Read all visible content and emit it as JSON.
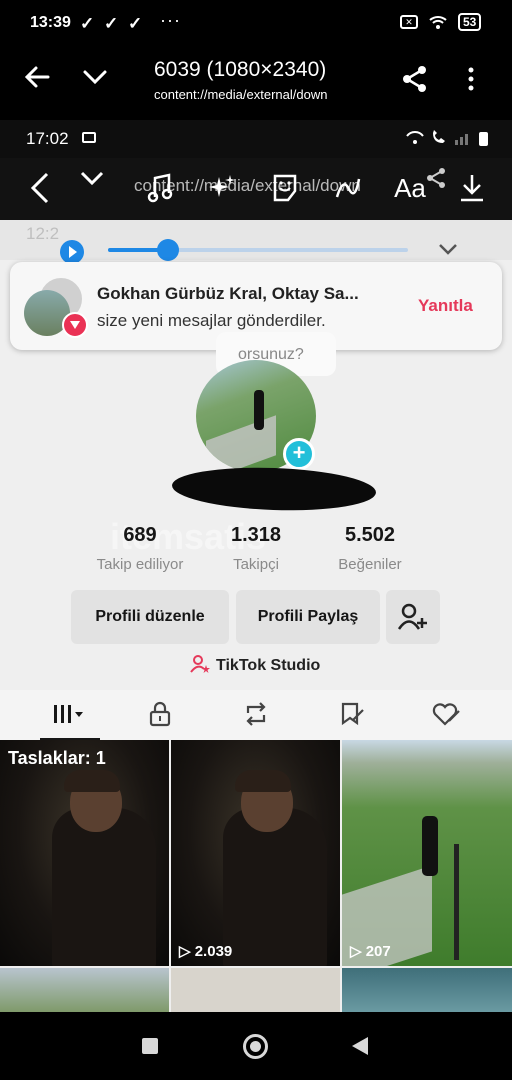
{
  "outer_status": {
    "time": "13:39",
    "dots": "···",
    "battery": "53",
    "check": "✓"
  },
  "viewer": {
    "title": "6039 (1080×2340)",
    "subtitle": "content://media/external/down"
  },
  "inner_status": {
    "time": "17:02"
  },
  "editor": {
    "ghost_url": "content://media/external/down",
    "text_tool_label": "Aa",
    "ghost_time": "12:2"
  },
  "notification": {
    "title": "Gokhan Gürbüz Kral, Oktay Sa...",
    "text": "size yeni mesajlar gönderdiler.",
    "reply_label": "Yanıtla"
  },
  "progress": {
    "fraction": 0.2
  },
  "profile": {
    "bubble_text": "orsunuz?",
    "plus": "+",
    "watermark": "itemsatis"
  },
  "stats": [
    {
      "value": "689",
      "label": "Takip ediliyor"
    },
    {
      "value": "1.318",
      "label": "Takipçi"
    },
    {
      "value": "5.502",
      "label": "Beğeniler"
    }
  ],
  "actions": {
    "edit_profile": "Profili düzenle",
    "share_profile": "Profili Paylaş"
  },
  "studio": {
    "label": "TikTok Studio",
    "icon": "person-star-icon"
  },
  "tabs": [
    "grid-icon",
    "lock-icon",
    "repost-icon",
    "favorites-icon",
    "liked-icon"
  ],
  "grid": {
    "draft_label": "Taslaklar: 1",
    "views": [
      "2.039",
      "207"
    ],
    "play": "▷"
  },
  "colors": {
    "accent_pink": "#e5395a",
    "accent_blue": "#1e88e5",
    "plus_teal": "#22bfd9"
  }
}
